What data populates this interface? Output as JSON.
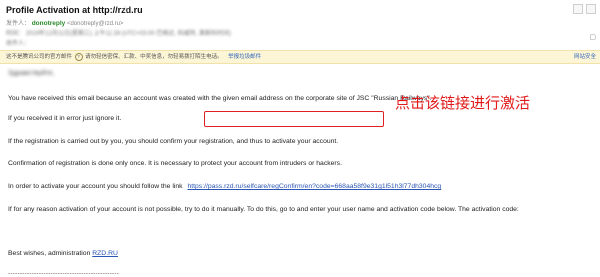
{
  "email": {
    "subject": "Profile Activation at http://rzd.ru",
    "star_icon": "☆",
    "sender_label": "发件人：",
    "sender_name": "donotreply",
    "sender_address": "<donotreply@rzd.ru>",
    "time_label": "时间：",
    "time_value": "2019年12月11日(星期三) 上午11:28 (UTC+03:00 巴格达, 科威特, 莫斯科时间)",
    "recipient_label": "收件人："
  },
  "warning_bar": {
    "text": "这不是腾讯公司的官方邮件",
    "text2": "请勿轻信密保、汇款、中奖信息，勿轻易拨打陌生电话。",
    "report_link": "举报垃圾邮件",
    "right_link": "网站安全"
  },
  "body": {
    "greeting": "Здравствуйте,",
    "p1": "You have received this email because an account was created with the given email address on the corporate site of JSC \"Russian Railways\".",
    "p2": "If you received it in error just ignore it.",
    "p3": "If the registration is carried out by you, you should confirm your registration, and thus to activate your account.",
    "p4": "Confirmation of registration is done only once. It is necessary to protect your account from intruders or hackers.",
    "p5_prefix": "In order to activate your account you should follow the link",
    "activation_link": "https://pass.rzd.ru/selfcare/regConfirm/en?code=668aa58f9e31g1l51h3l77dh304hcg",
    "p6": "If for any reason activation of your account is not possible, try to do it manually. To do this, go to and enter your user name and activation code below. The activation code:",
    "sign_off": "Best wishes, administration",
    "sign_link": "RZD.RU",
    "separator": "-----------------------------------------------"
  },
  "annotation": {
    "text": "点击该链接进行激活",
    "color": "#e11a1a"
  }
}
